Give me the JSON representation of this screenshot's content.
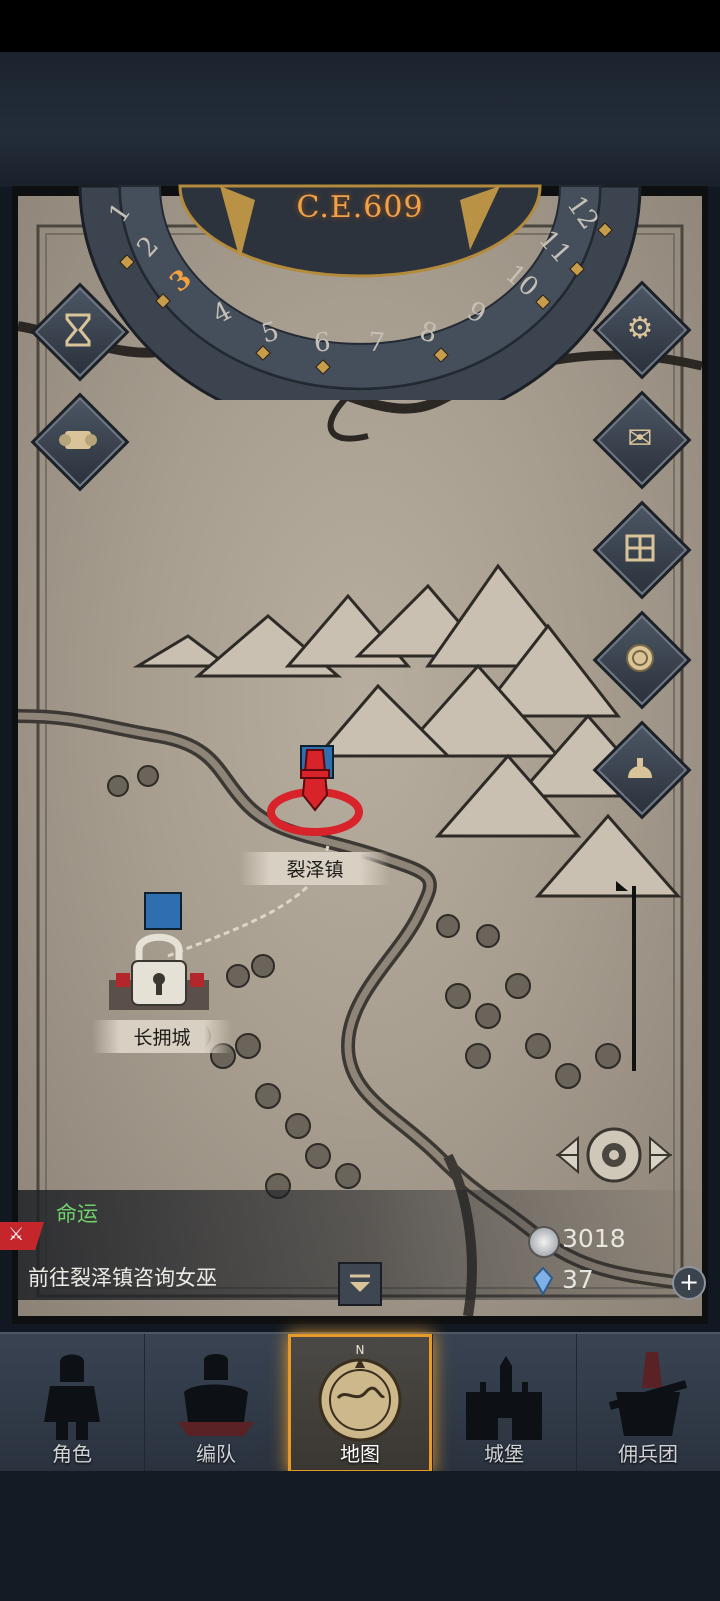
{
  "calendar": {
    "era": "C.E.609",
    "months": [
      "1",
      "2",
      "3",
      "4",
      "5",
      "6",
      "7",
      "8",
      "9",
      "10",
      "11",
      "12"
    ],
    "current_month": "3"
  },
  "left_buttons": [
    {
      "icon": "hourglass-icon"
    },
    {
      "icon": "scroll-icon"
    }
  ],
  "right_buttons": [
    {
      "icon": "gear-icon"
    },
    {
      "icon": "mail-icon"
    },
    {
      "icon": "grid-window-icon"
    },
    {
      "icon": "coin-icon"
    },
    {
      "icon": "helmet-icon"
    }
  ],
  "locations": [
    {
      "name": "裂泽镇",
      "state": "current"
    },
    {
      "name": "长拥城",
      "state": "locked"
    }
  ],
  "quest": {
    "type": "命运",
    "description": "前往裂泽镇咨询女巫"
  },
  "resources": {
    "silver": "3018",
    "crystal": "37"
  },
  "nav": {
    "items": [
      {
        "label": "角色",
        "icon": "knight-icon"
      },
      {
        "label": "编队",
        "icon": "formation-icon"
      },
      {
        "label": "地图",
        "icon": "compass-map-icon"
      },
      {
        "label": "城堡",
        "icon": "castle-icon"
      },
      {
        "label": "佣兵团",
        "icon": "mercenary-icon"
      }
    ],
    "active": "地图"
  },
  "colors": {
    "accent": "#e59a2a",
    "quest_type": "#6fd26b",
    "era_text": "#f0a24a",
    "marker_red": "#d8232a"
  }
}
